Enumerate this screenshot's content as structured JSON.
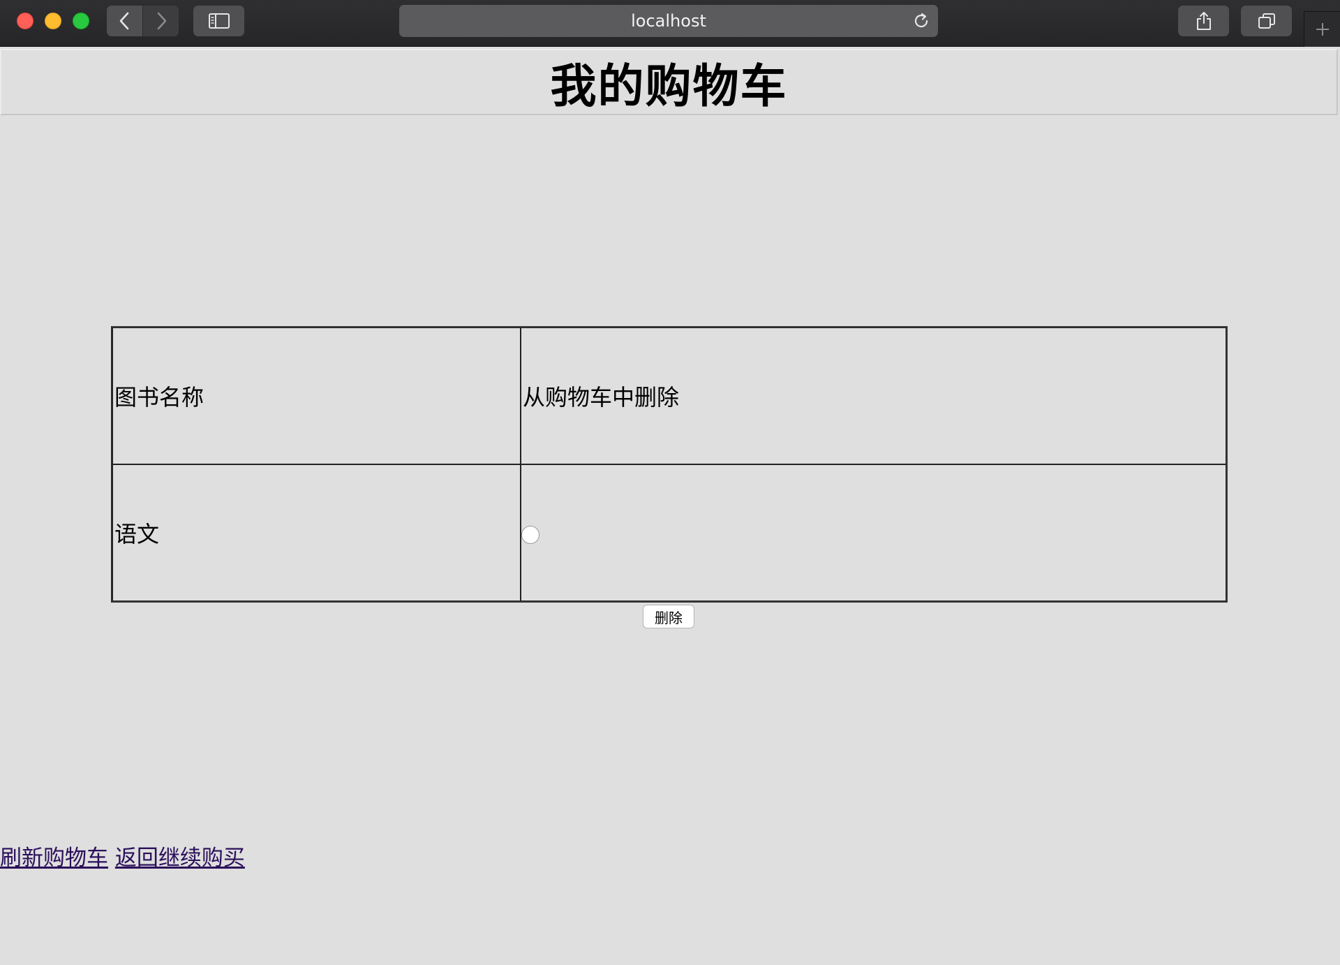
{
  "browser": {
    "url": "localhost",
    "colors": {
      "close": "#fe5f57",
      "minimize": "#febc2e",
      "maximize": "#28c840"
    },
    "icons": {
      "back": "chevron-left-icon",
      "forward": "chevron-right-icon",
      "sidebar": "sidebar-icon",
      "reload": "reload-icon",
      "share": "share-icon",
      "tabs": "tabs-overview-icon",
      "new_tab": "plus-icon"
    }
  },
  "page": {
    "title": "我的购物车",
    "table": {
      "headers": [
        "图书名称",
        "从购物车中删除"
      ],
      "rows": [
        {
          "name": "语文",
          "selected": false
        }
      ]
    },
    "delete_button": "删除",
    "links": {
      "refresh": "刷新购物车",
      "back_to_shop": "返回继续购买"
    },
    "colors": {
      "background": "#dfdfdf",
      "link": "#2a0f5a"
    }
  }
}
